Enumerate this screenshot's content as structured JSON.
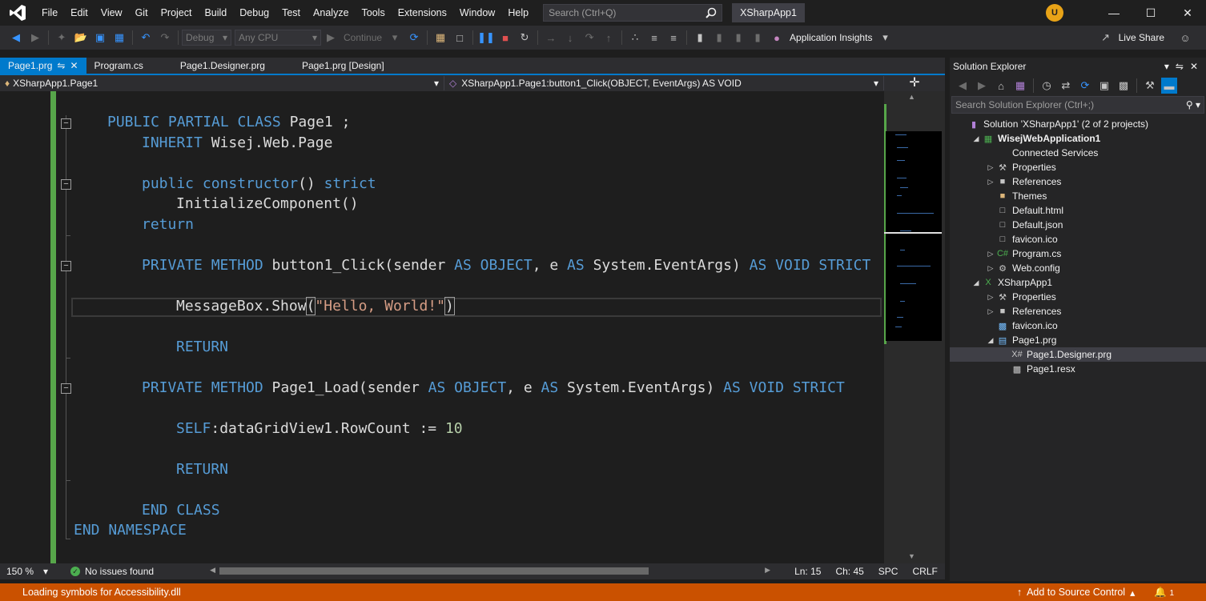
{
  "menu": {
    "items": [
      "File",
      "Edit",
      "View",
      "Git",
      "Project",
      "Build",
      "Debug",
      "Test",
      "Analyze",
      "Tools",
      "Extensions",
      "Window",
      "Help"
    ],
    "search_placeholder": "Search (Ctrl+Q)",
    "app_title": "XSharpApp1"
  },
  "toolbar": {
    "config_combo": "Debug",
    "platform_combo": "Any CPU",
    "continue_label": "Continue",
    "app_insights_label": "Application Insights",
    "live_share_label": "Live Share"
  },
  "doc_tabs": {
    "active": "Page1.prg",
    "tabs": [
      "Program.cs",
      "Page1.Designer.prg",
      "Page1.prg [Design]"
    ]
  },
  "nav_bar": {
    "left": "XSharpApp1.Page1",
    "right": "XSharpApp1.Page1:button1_Click(OBJECT, EventArgs) AS VOID"
  },
  "code": {
    "l1": [
      "PUBLIC PARTIAL CLASS",
      " Page1 ;"
    ],
    "l2": [
      "INHERIT",
      " Wisej.Web.Page"
    ],
    "l3": [
      "public constructor",
      "() ",
      "strict"
    ],
    "l4": "InitializeComponent()",
    "l5": "return",
    "l6": [
      "PRIVATE METHOD",
      " button1_Click(sender ",
      "AS OBJECT",
      ", e ",
      "AS",
      " System.EventArgs) ",
      "AS VOID STRICT"
    ],
    "l7": [
      "MessageBox.Show",
      "(",
      "\"Hello, World!\"",
      ")"
    ],
    "l8": "RETURN",
    "l9": [
      "PRIVATE METHOD",
      " Page1_Load(sender ",
      "AS OBJECT",
      ", e ",
      "AS",
      " System.EventArgs) ",
      "AS VOID STRICT"
    ],
    "l10": [
      "SELF",
      ":dataGridView1.RowCount := ",
      "10"
    ],
    "l11": "RETURN",
    "l12": "END CLASS",
    "l13": "END NAMESPACE"
  },
  "editor_status": {
    "zoom": "150 %",
    "issues": "No issues found",
    "line": "Ln: 15",
    "col": "Ch: 45",
    "spacing": "SPC",
    "eol": "CRLF"
  },
  "solution_explorer": {
    "title": "Solution Explorer",
    "search_placeholder": "Search Solution Explorer (Ctrl+;)",
    "tree": [
      {
        "label": "Solution 'XSharpApp1' (2 of 2 projects)",
        "depth": 0,
        "arrow": "",
        "icon": "solution-icon"
      },
      {
        "label": "WisejWebApplication1",
        "depth": 1,
        "arrow": "open",
        "icon": "web-project-icon",
        "bold": true
      },
      {
        "label": "Connected Services",
        "depth": 2,
        "arrow": "",
        "icon": "connected-services-icon"
      },
      {
        "label": "Properties",
        "depth": 2,
        "arrow": "closed",
        "icon": "wrench-icon"
      },
      {
        "label": "References",
        "depth": 2,
        "arrow": "closed",
        "icon": "references-icon"
      },
      {
        "label": "Themes",
        "depth": 2,
        "arrow": "",
        "icon": "folder-icon"
      },
      {
        "label": "Default.html",
        "depth": 2,
        "arrow": "",
        "icon": "file-icon"
      },
      {
        "label": "Default.json",
        "depth": 2,
        "arrow": "",
        "icon": "file-icon"
      },
      {
        "label": "favicon.ico",
        "depth": 2,
        "arrow": "",
        "icon": "file-icon"
      },
      {
        "label": "Program.cs",
        "depth": 2,
        "arrow": "closed",
        "icon": "csharp-icon"
      },
      {
        "label": "Web.config",
        "depth": 2,
        "arrow": "closed",
        "icon": "config-icon"
      },
      {
        "label": "XSharpApp1",
        "depth": 1,
        "arrow": "open",
        "icon": "xsharp-project-icon"
      },
      {
        "label": "Properties",
        "depth": 2,
        "arrow": "closed",
        "icon": "wrench-icon"
      },
      {
        "label": "References",
        "depth": 2,
        "arrow": "closed",
        "icon": "references-icon"
      },
      {
        "label": "favicon.ico",
        "depth": 2,
        "arrow": "",
        "icon": "image-icon"
      },
      {
        "label": "Page1.prg",
        "depth": 2,
        "arrow": "open",
        "icon": "form-icon"
      },
      {
        "label": "Page1.Designer.prg",
        "depth": 3,
        "arrow": "",
        "icon": "xsharp-file-icon",
        "selected": true
      },
      {
        "label": "Page1.resx",
        "depth": 3,
        "arrow": "",
        "icon": "resx-icon"
      }
    ]
  },
  "statusbar": {
    "text": "Loading symbols for Accessibility.dll",
    "source_control": "Add to Source Control",
    "notifications": "1"
  },
  "colors": {
    "accent": "#007acc",
    "status_bar": "#ca5100",
    "keyword": "#569cd6",
    "string": "#d69d85",
    "change_margin": "#57a64a"
  }
}
